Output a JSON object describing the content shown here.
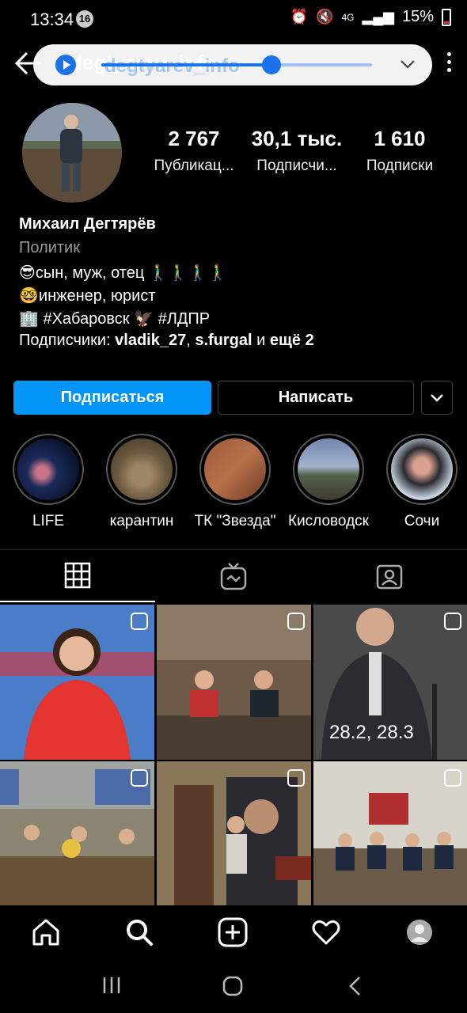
{
  "status_bar": {
    "time": "13:34",
    "notification_count": "16",
    "network": "4G",
    "battery": "15%"
  },
  "header": {
    "username": "degtyarev_info",
    "media_overlay": {
      "progress": 0.63
    }
  },
  "profile": {
    "stats": [
      {
        "value": "2 767",
        "label": "Публикац..."
      },
      {
        "value": "30,1 тыс.",
        "label": "Подписчи..."
      },
      {
        "value": "1 610",
        "label": "Подписки"
      }
    ],
    "name": "Михаил Дегтярёв",
    "category": "Политик",
    "bio_lines": [
      "😎сын, муж, отец 🚶‍♂️🚶‍♂️🚶‍♂️🚶‍♂️",
      "🤓инженер, юрист",
      "🏢 #Хабаровск 🦅 #ЛДПР"
    ],
    "followers_prefix": "Подписчики: ",
    "followers_user1": "vladik_27",
    "followers_sep": ", ",
    "followers_user2": "s.furgal",
    "followers_and": " и ",
    "followers_more": "ещё 2"
  },
  "buttons": {
    "follow": "Подписаться",
    "message": "Написать"
  },
  "highlights": [
    {
      "label": "LIFE"
    },
    {
      "label": "карантин"
    },
    {
      "label": "ТК \"Звезда\""
    },
    {
      "label": "Кисловодск"
    },
    {
      "label": "Сочи"
    }
  ],
  "tabs": [
    {
      "icon": "grid-icon",
      "active": true
    },
    {
      "icon": "igtv-icon",
      "active": false
    },
    {
      "icon": "tagged-icon",
      "active": false
    }
  ],
  "grid": {
    "caption_cell_3": "28.2, 28.3"
  },
  "bottom_nav": [
    "home-icon",
    "search-icon",
    "new-post-icon",
    "activity-icon",
    "profile-avatar"
  ],
  "colors": {
    "accent": "#0095f6",
    "background": "#000000",
    "secondary_text": "#9a9a9a"
  }
}
